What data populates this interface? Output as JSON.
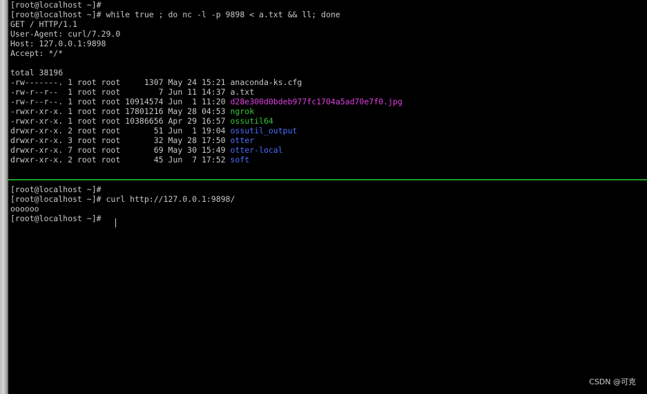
{
  "top_terminal": {
    "lines": [
      "[root@localhost ~]#",
      "[root@localhost ~]# while true ; do nc -l -p 9898 < a.txt && ll; done",
      "GET / HTTP/1.1",
      "User-Agent: curl/7.29.0",
      "Host: 127.0.0.1:9898",
      "Accept: */*",
      "",
      "total 38196"
    ],
    "listing": [
      {
        "meta": "-rw-------. 1 root root     1307 May 24 15:21 ",
        "name": "anaconda-ks.cfg",
        "color": "#c8c8c8"
      },
      {
        "meta": "-rw-r--r--  1 root root        7 Jun 11 14:37 ",
        "name": "a.txt",
        "color": "#c8c8c8"
      },
      {
        "meta": "-rw-r--r--. 1 root root 10914574 Jun  1 11:20 ",
        "name": "d28e300d0bdeb977fc1704a5ad70e7f0.jpg",
        "color": "#e040e0"
      },
      {
        "meta": "-rwxr-xr-x. 1 root root 17801216 May 28 04:53 ",
        "name": "ngrok",
        "color": "#34c934"
      },
      {
        "meta": "-rwxr-xr-x. 1 root root 10386656 Apr 29 16:57 ",
        "name": "ossutil64",
        "color": "#34c934"
      },
      {
        "meta": "drwxr-xr-x. 2 root root       51 Jun  1 19:04 ",
        "name": "ossutil_output",
        "color": "#4d6dff"
      },
      {
        "meta": "drwxr-xr-x. 3 root root       32 May 28 17:50 ",
        "name": "otter",
        "color": "#4d6dff"
      },
      {
        "meta": "drwxr-xr-x. 7 root root       69 May 30 15:49 ",
        "name": "otter-local",
        "color": "#4d6dff"
      },
      {
        "meta": "drwxr-xr-x. 2 root root       45 Jun  7 17:52 ",
        "name": "soft",
        "color": "#4d6dff"
      }
    ]
  },
  "bottom_terminal": {
    "lines": [
      "[root@localhost ~]#",
      "[root@localhost ~]# curl http://127.0.0.1:9898/",
      "oooooo",
      "[root@localhost ~]# "
    ]
  },
  "watermark": "CSDN @可克",
  "colors": {
    "background": "#000000",
    "text": "#c8c8c8",
    "image_file": "#e040e0",
    "executable": "#34c934",
    "directory": "#4d6dff",
    "pane_divider": "#18a318"
  }
}
